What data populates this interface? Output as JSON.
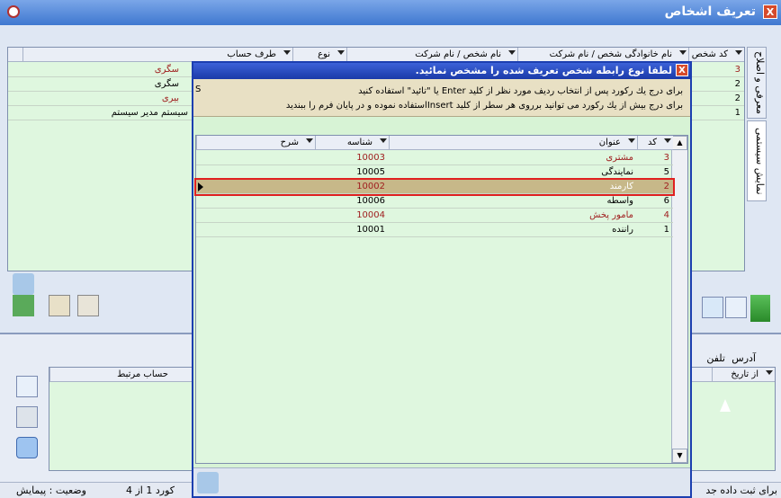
{
  "window": {
    "title": "تعریف اشخاص",
    "close": "X"
  },
  "left_tabs": [
    "معرفی و اصلاح",
    "نمایش سیستمی"
  ],
  "bg_grid": {
    "headers": [
      "کد شخص",
      "نام خانوادگی شخص / نام شرکت",
      "نام شخص / نام شرکت",
      "نوع",
      "طرف حساب"
    ],
    "rows": [
      {
        "code": "3",
        "name": "سگری"
      },
      {
        "code": "2",
        "name": "سگری"
      },
      {
        "code": "2",
        "name": "بیری"
      },
      {
        "code": "1",
        "name": "سیستم مدیر سیستم"
      }
    ]
  },
  "dialog": {
    "title": "لطفا نوع رابطه شخص تعریف شده را مشخص نمائید.",
    "note_line1": "برای درج یك ركورد پس از انتخاب ردیف مورد نظر از كلید Enter یا \"تائید\" استفاده كنید",
    "note_line2": "برای درج بیش از یك ركورد می توانید برروی هر سطر از كلید Insertاستفاده نموده و در پایان فرم را ببندید",
    "headers": {
      "code": "کد",
      "title": "عنوان",
      "id": "شناسه",
      "desc": "شرح"
    },
    "rows": [
      {
        "code": "3",
        "title": "مشتری",
        "id": "10003",
        "red": true
      },
      {
        "code": "5",
        "title": "نمایندگی",
        "id": "10005",
        "red": false
      },
      {
        "code": "2",
        "title": "کارمند",
        "id": "10002",
        "red": true,
        "selected": true
      },
      {
        "code": "6",
        "title": "واسطه",
        "id": "10006",
        "red": false
      },
      {
        "code": "4",
        "title": "مامور پخش",
        "id": "10004",
        "red": true
      },
      {
        "code": "1",
        "title": "راننده",
        "id": "10001",
        "red": false
      }
    ]
  },
  "lower": {
    "tabs": [
      "آدرس",
      "تلفن"
    ],
    "headers": [
      "از تاریخ",
      "حساب مرتبط"
    ],
    "s_label": "S"
  },
  "status": {
    "left": "وضعیت : پیمایش",
    "record": "كورد 1 از 4",
    "right": "برای ثبت داده جد"
  },
  "colors": {
    "accent": "#1c3fb0",
    "grid_bg": "#dff7df",
    "red_text": "#a02020",
    "selection_border": "#e02020"
  }
}
